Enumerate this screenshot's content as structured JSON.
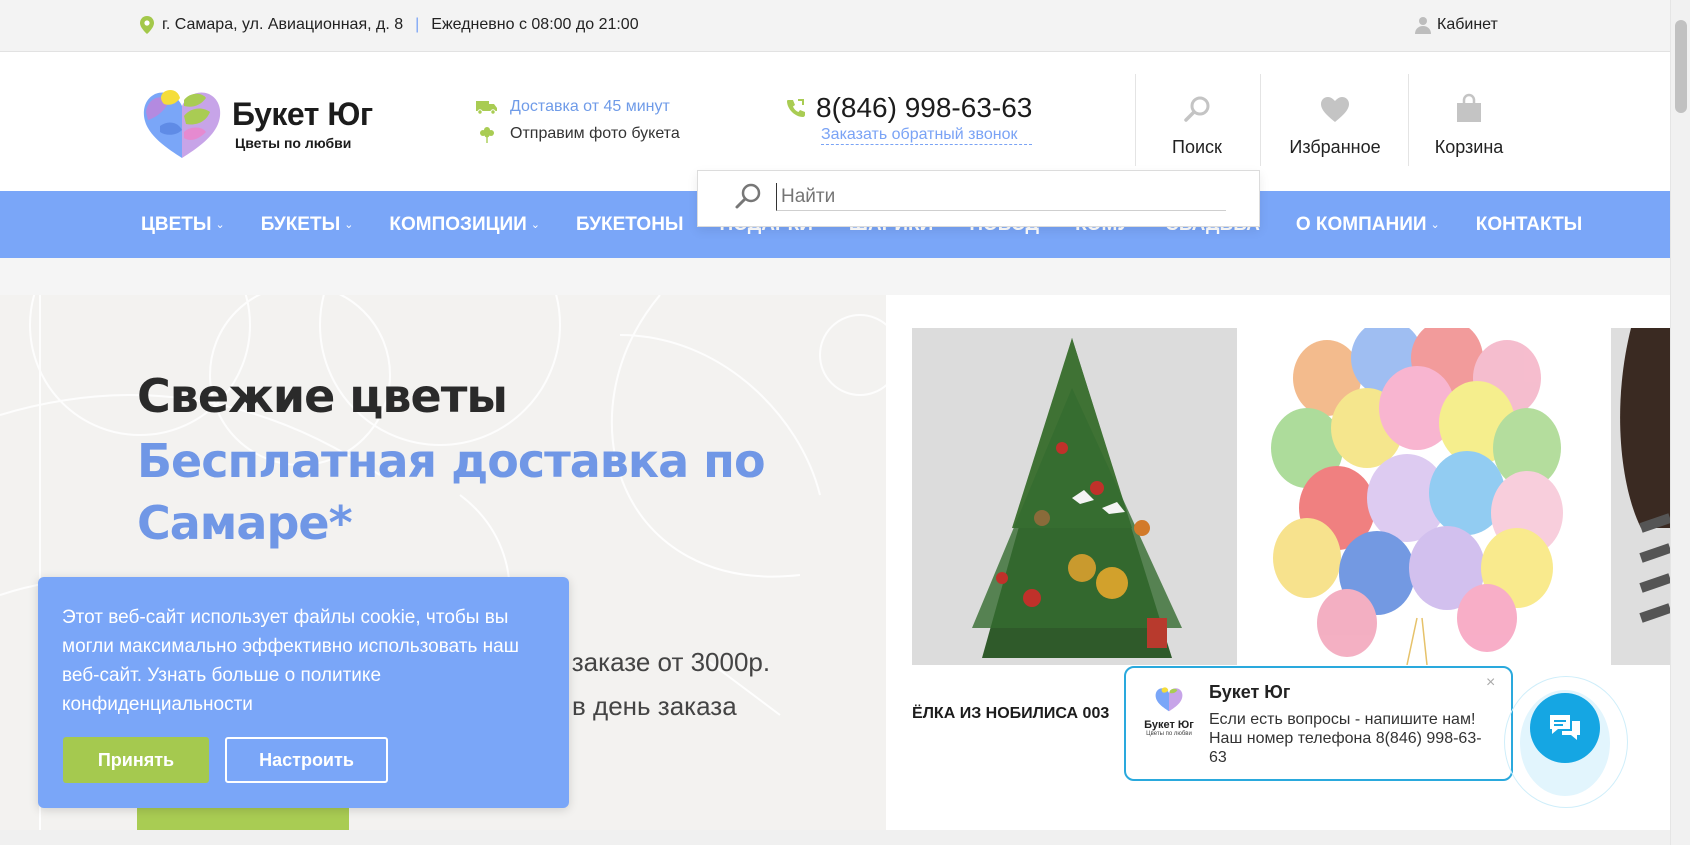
{
  "topbar": {
    "address": "г. Самара, ул. Авиационная, д. 8",
    "hours": "Ежедневно с 08:00 до 21:00",
    "separator": "|",
    "cabinet": "Кабинет"
  },
  "header": {
    "logo_name": "Букет Юг",
    "logo_tagline": "Цветы по любви",
    "delivery": "Доставка от 45 минут",
    "photo": "Отправим фото букета",
    "phone": "8(846) 998-63-63",
    "callback": "Заказать обратный звонок",
    "search": "Поиск",
    "favorites": "Избранное",
    "cart": "Корзина"
  },
  "search": {
    "placeholder": "Найти"
  },
  "nav": {
    "items": [
      {
        "label": "ЦВЕТЫ",
        "chevron": "⌄"
      },
      {
        "label": "БУКЕТЫ",
        "chevron": "⌄"
      },
      {
        "label": "КОМПОЗИЦИИ",
        "chevron": "⌄"
      },
      {
        "label": "БУКЕТОНЫ",
        "chevron": ""
      },
      {
        "label": "ПОДАРКИ",
        "chevron": ""
      },
      {
        "label": "ШАРИКИ",
        "chevron": ""
      },
      {
        "label": "ПОВОД",
        "chevron": ""
      },
      {
        "label": "КОМУ",
        "chevron": ""
      },
      {
        "label": "СВАДЬБА",
        "chevron": ""
      },
      {
        "label": "О КОМПАНИИ",
        "chevron": "⌄"
      },
      {
        "label": "КОНТАКТЫ",
        "chevron": ""
      }
    ]
  },
  "hero": {
    "title": "Свежие цветы",
    "subtitle": "Бесплатная доставка по Самаре*",
    "line1": "и заказе от 3000р.",
    "line2": "в день заказа"
  },
  "products": [
    {
      "name": "ЁЛКА ИЗ НОБИЛИСА 003"
    }
  ],
  "cookie": {
    "text": "Этот веб-сайт использует файлы cookie, чтобы вы могли максимально эффективно использовать наш веб-сайт. Узнать больше о политике конфиденциальности",
    "accept": "Принять",
    "settings": "Настроить"
  },
  "chat": {
    "title": "Букет Юг",
    "message": "Если есть вопросы - напишите нам! Наш номер телефона 8(846) 998-63-63",
    "close": "×",
    "logo_name": "Букет Юг",
    "logo_tagline": "Цветы по любви"
  },
  "colors": {
    "accent_blue": "#7aa6f8",
    "accent_green": "#a9cc53",
    "chat_blue": "#15a6e3"
  }
}
